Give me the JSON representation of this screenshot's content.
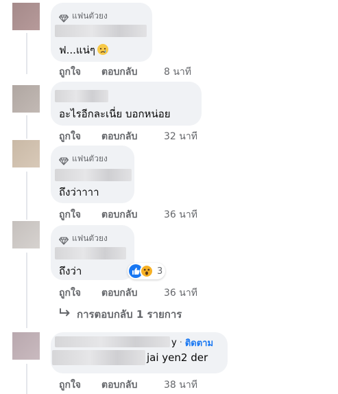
{
  "colors": {
    "bubble": "#f0f2f5",
    "muted": "#65676b",
    "link": "#1877f2",
    "like_blue": "#1877f2",
    "wow_yellow": "#f7b125"
  },
  "comments": [
    {
      "badge": "แฟนตัวยง",
      "text": "ฟ...แน่ๆ",
      "emoji": "crying-face",
      "like": "ถูกใจ",
      "reply": "ตอบกลับ",
      "time": "8 นาที"
    },
    {
      "badge": "",
      "text": "อะไรอีกละเนี่ย บอกหน่อย",
      "like": "ถูกใจ",
      "reply": "ตอบกลับ",
      "time": "32 นาที"
    },
    {
      "badge": "แฟนตัวยง",
      "text": "ถึงว่าาาา",
      "like": "ถูกใจ",
      "reply": "ตอบกลับ",
      "time": "36 นาที"
    },
    {
      "badge": "แฟนตัวยง",
      "text": "ถึงว่า",
      "reactions": {
        "types": [
          "like-icon",
          "wow-icon"
        ],
        "count": "3"
      },
      "like": "ถูกใจ",
      "reply": "ตอบกลับ",
      "time": "36 นาที"
    },
    {
      "name_suffix": "y",
      "dot": "·",
      "follow": "ติดตาม",
      "text_suffix": "jai yen2 der",
      "like": "ถูกใจ",
      "reply": "ตอบกลับ",
      "time": "38 นาที"
    }
  ],
  "more_replies": {
    "icon": "reply-arrow-icon",
    "label": "การตอบกลับ 1 รายการ"
  }
}
